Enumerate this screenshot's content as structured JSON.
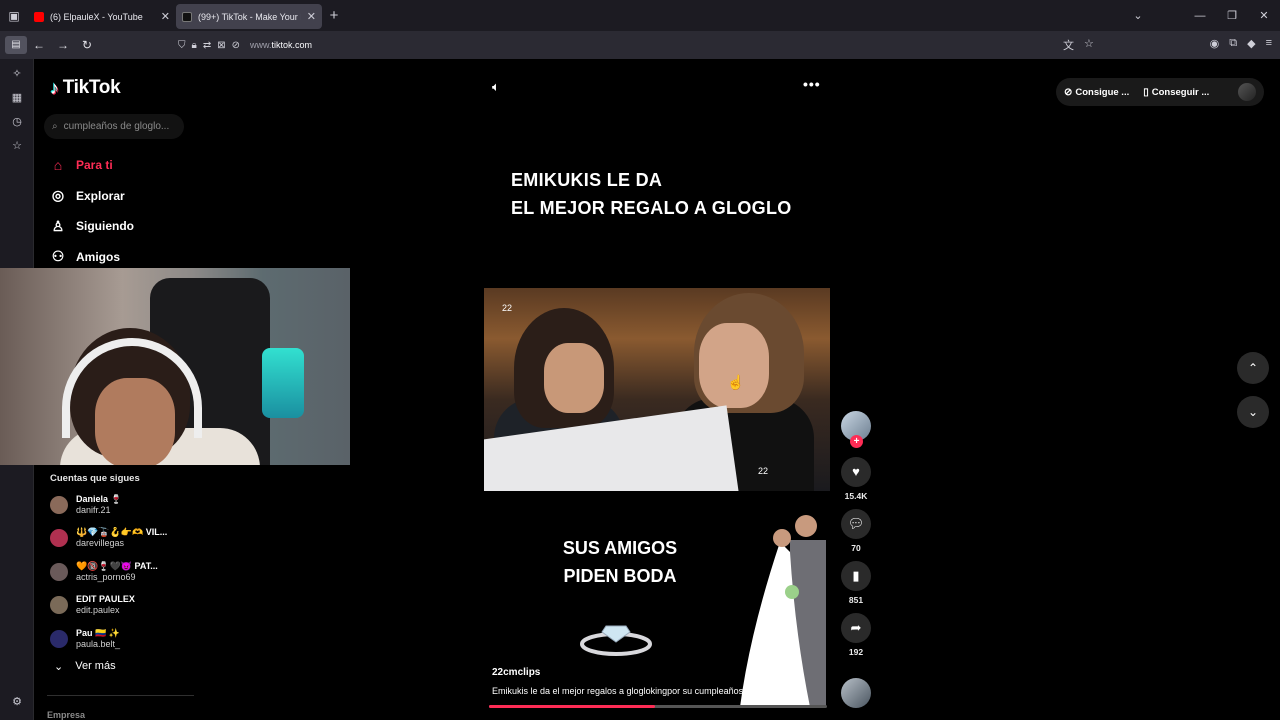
{
  "browser": {
    "tabs": [
      {
        "title": "(6) ElpauleX - YouTube",
        "favicon_color": "#ff0000",
        "active": false
      },
      {
        "title": "(99+) TikTok - Make Your Day",
        "favicon_color": "#111111",
        "active": true
      }
    ],
    "url": {
      "prefix": "www.",
      "domain": "tiktok.com"
    }
  },
  "tiktok": {
    "logo_text": "TikTok",
    "search_placeholder": "cumpleaños de gloglo...",
    "menu": [
      {
        "label": "Para ti",
        "icon": "home-icon",
        "active": true
      },
      {
        "label": "Explorar",
        "icon": "compass-icon",
        "active": false
      },
      {
        "label": "Siguiendo",
        "icon": "user-icon",
        "active": false
      },
      {
        "label": "Amigos",
        "icon": "friends-icon",
        "active": false
      }
    ],
    "following_header": "Cuentas que sigues",
    "following": [
      {
        "name": "Daniela 🍷",
        "username": "danifr.21",
        "avatar_color": "#8a6a5a"
      },
      {
        "name": "🔱💎🚡🪝👉🫶 VIL...",
        "username": "darevillegas",
        "avatar_color": "#b03050"
      },
      {
        "name": "🧡🔞🍷🖤😈 PAT...",
        "username": "actris_porno69",
        "avatar_color": "#6a5a5a"
      },
      {
        "name": "EDIT PAULEX",
        "username": "edit.paulex",
        "avatar_color": "#7a6a58"
      },
      {
        "name": "Pau 🇨🇴 ✨",
        "username": "paula.belt_",
        "avatar_color": "#2a2a6a"
      }
    ],
    "ver_mas": "Ver más",
    "empresa": "Empresa",
    "top_right": {
      "get_app": "Consigue ...",
      "get_coins": "Conseguir ..."
    }
  },
  "video": {
    "caption_top_line1": "EMIKUKIS LE DA",
    "caption_top_line2": "EL MEJOR REGALO A GLOGLO",
    "clip_number_top": "22",
    "clip_number_bottom": "22",
    "boda_line1": "SUS AMIGOS",
    "boda_line2": "PIDEN BODA",
    "author": "22cmclips",
    "description": "Emikukis le da el mejor regalos a gloglokingpor su cumpleaños y junt... más",
    "progress": 0.49,
    "likes": "15.4K",
    "comments": "70",
    "saves": "851",
    "shares": "192"
  }
}
